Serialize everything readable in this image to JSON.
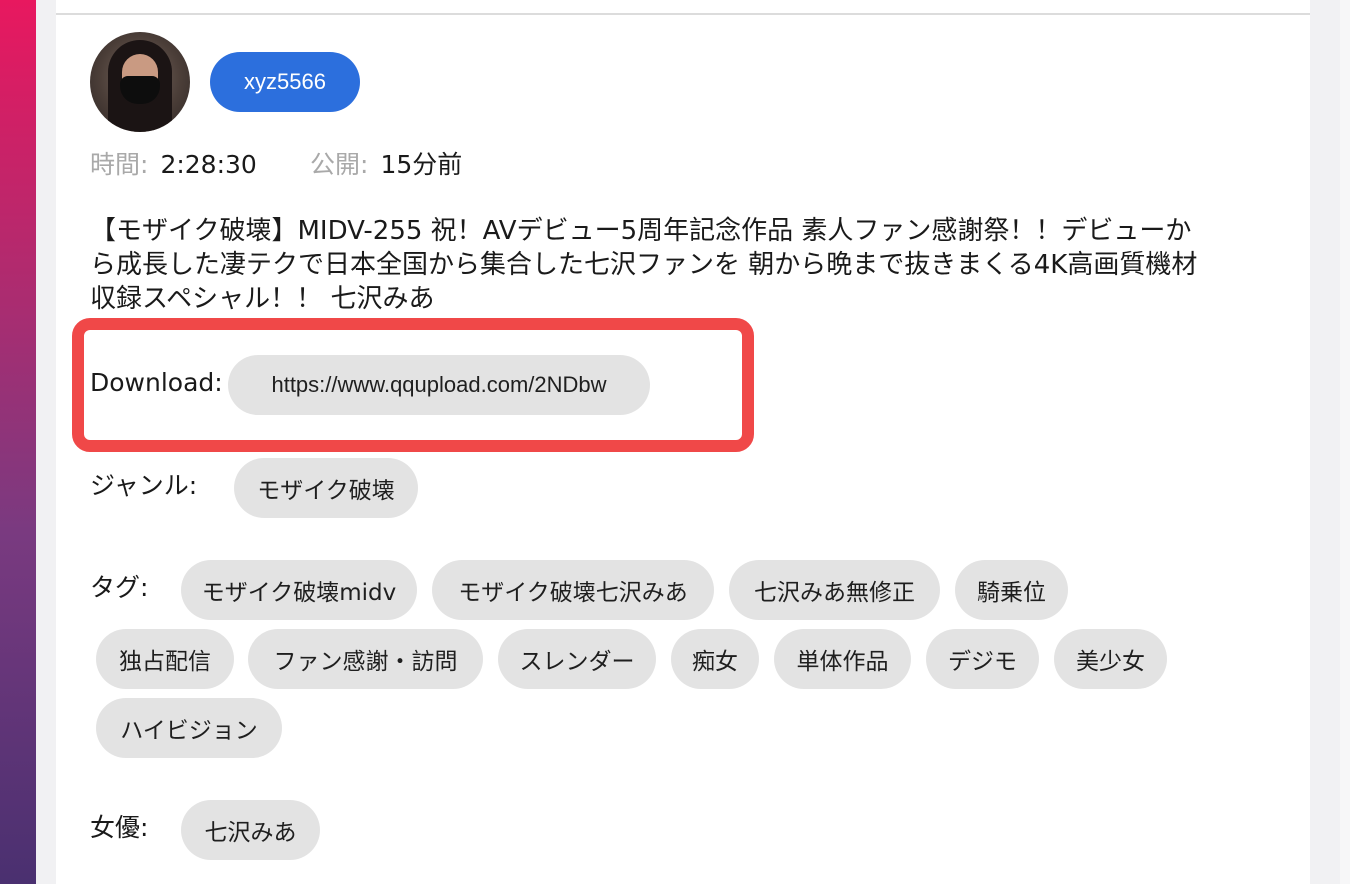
{
  "user": {
    "name": "xyz5566"
  },
  "meta": {
    "time_label": "時間:",
    "time_value": "2:28:30",
    "published_label": "公開:",
    "published_value": "15分前"
  },
  "title": "【モザイク破壊】MIDV-255 祝！AVデビュー5周年記念作品 素人ファン感謝祭！！デビューから成長した凄テクで日本全国から集合した七沢ファンを 朝から晩まで抜きまくる4K高画質機材収録スペシャル！！ 七沢みあ",
  "download": {
    "label": "Download:",
    "url": "https://www.qqupload.com/2NDbw"
  },
  "genre": {
    "label": "ジャンル:",
    "items": [
      "モザイク破壊"
    ]
  },
  "tags": {
    "label": "タグ:",
    "items": [
      "モザイク破壊midv",
      "モザイク破壊七沢みあ",
      "七沢みあ無修正",
      "騎乗位",
      "独占配信",
      "ファン感謝・訪問",
      "スレンダー",
      "痴女",
      "単体作品",
      "デジモ",
      "美少女",
      "ハイビジョン"
    ]
  },
  "actress": {
    "label": "女優:",
    "items": [
      "七沢みあ"
    ]
  },
  "colors": {
    "accent": "#2c6fdd",
    "highlight": "#f04848",
    "chip": "#e3e3e3"
  }
}
